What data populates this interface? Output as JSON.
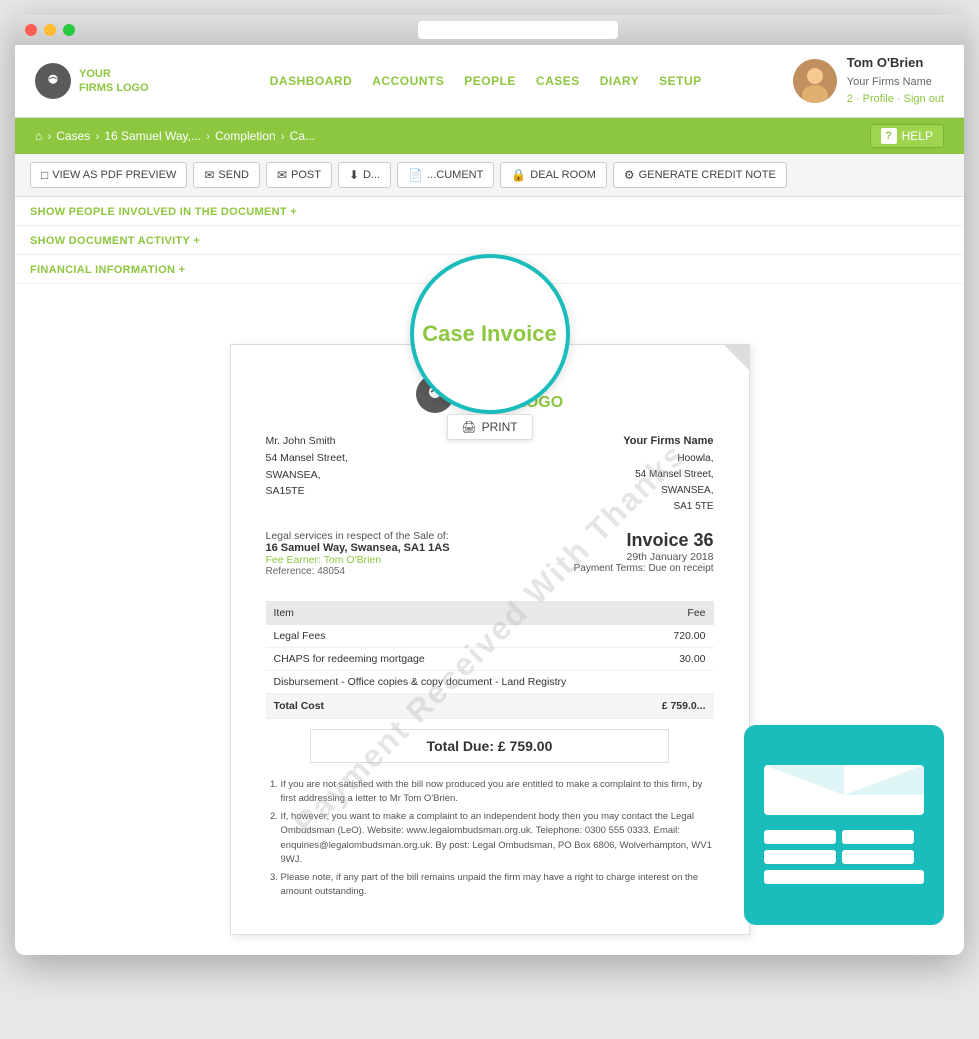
{
  "window": {
    "title": "Case Invoice"
  },
  "nav": {
    "logo_line1": "YOUR",
    "logo_line2": "FIRMS LOGO",
    "links": [
      "DASHBOARD",
      "ACCOUNTS",
      "PEOPLE",
      "CASES",
      "DIARY",
      "SETUP"
    ],
    "active_link": "CASES",
    "user": {
      "name": "Tom O'Brien",
      "firm": "Your Firms Name",
      "message_count": "2",
      "profile_link": "Profile",
      "signout_link": "Sign out"
    }
  },
  "breadcrumb": {
    "home": "⌂",
    "items": [
      "Cases",
      "16 Samuel Way,...",
      "Completion",
      "Ca..."
    ],
    "help": "HELP"
  },
  "toolbar": {
    "buttons": [
      {
        "label": "VIEW AS PDF PREVIEW",
        "icon": "□"
      },
      {
        "label": "SEND",
        "icon": "✉"
      },
      {
        "label": "POST",
        "icon": "✉"
      },
      {
        "label": "D...",
        "icon": "⬇"
      },
      {
        "label": "...CUMENT",
        "icon": "📄"
      },
      {
        "label": "DEAL ROOM",
        "icon": "🔒"
      },
      {
        "label": "GENERATE CREDIT NOTE",
        "icon": "⚙"
      }
    ]
  },
  "sections": {
    "people": "SHOW PEOPLE INVOLVED IN THE DOCUMENT +",
    "activity": "SHOW DOCUMENT ACTIVITY +",
    "financial": "FINANCIAL INFORMATION +"
  },
  "invoice_circle": {
    "title": "Case Invoice",
    "print_label": "PRINT"
  },
  "invoice": {
    "watermark": "Payment Received With Thanks",
    "logo_line1": "YOUR",
    "logo_line2": "FIRMS LOGO",
    "firm_address": {
      "name": "Your Firms Name",
      "line1": "Hoowla,",
      "line2": "54 Mansel Street,",
      "line3": "SWANSEA,",
      "line4": "SA1 5TE"
    },
    "client_address": {
      "salutation": "Mr. John Smith",
      "line1": "54 Mansel Street,",
      "line2": "SWANSEA,",
      "line3": "SA15TE"
    },
    "property_intro": "Legal services in respect of the Sale of:",
    "property_address": "16 Samuel Way, Swansea, SA1 1AS",
    "fee_earner": "Fee Earner: Tom O'Brien",
    "reference": "Reference: 48054",
    "invoice_number": "Invoice 36",
    "invoice_date": "29th January 2018",
    "payment_terms": "Payment Terms: Due on receipt",
    "table": {
      "headers": [
        "Item",
        "Fee"
      ],
      "rows": [
        {
          "item": "Legal Fees",
          "fee": "720.00"
        },
        {
          "item": "CHAPS for redeeming mortgage",
          "fee": "30.00"
        },
        {
          "item": "Disbursement - Office copies & copy document - Land Registry",
          "fee": ""
        }
      ],
      "total_label": "Total Cost",
      "total_value": "£ 759.0..."
    },
    "total_due": "Total Due:  £ 759.00",
    "footnotes": [
      "If you are not satisfied with the bill now produced you are entitled to make a complaint to this firm, by first addressing a letter to Mr Tom O'Brien.",
      "If, however, you want to make a complaint to an independent body then you may contact the Legal Ombudsman (LeO). Website: www.legalombudsman.org.uk. Telephone: 0300 555 0333. Email: enquiries@legalombudsman.org.uk. By post: Legal Ombudsman, PO Box 6806, Wolverhampton, WV1 9WJ.",
      "Please note, if any part of the bill remains unpaid the firm may have a right to charge interest on the amount outstanding."
    ]
  }
}
